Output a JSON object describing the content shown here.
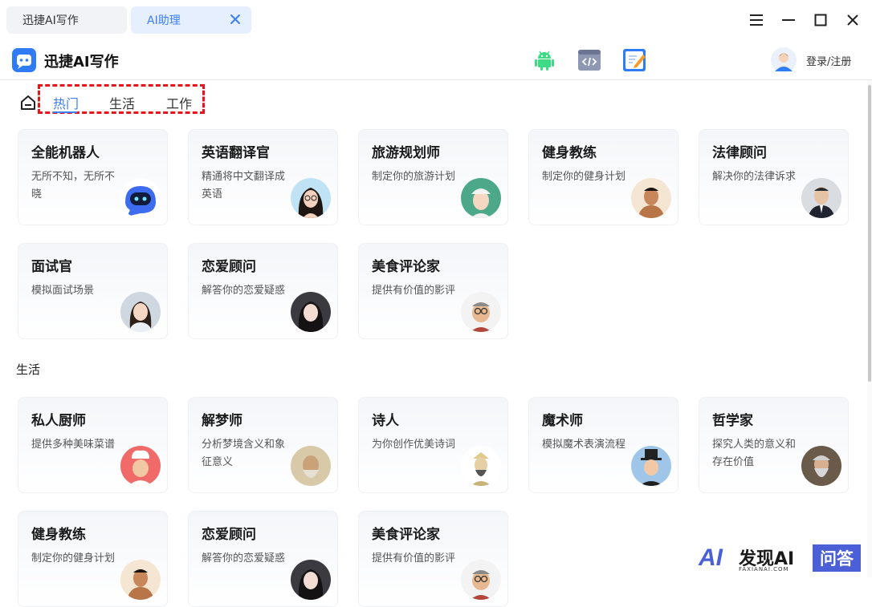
{
  "tabs": [
    {
      "label": "迅捷AI写作"
    },
    {
      "label": "AI助理"
    }
  ],
  "header": {
    "app_title": "迅捷AI写作",
    "login": "登录/注册",
    "icons": [
      "android-icon",
      "code-icon",
      "edit-icon"
    ]
  },
  "categories": [
    "热门",
    "生活",
    "工作"
  ],
  "active_category": "热门",
  "section_life": "生活",
  "cards_hot": [
    {
      "name": "全能机器人",
      "desc": "无所不知，无所不晓",
      "avatar": "robot"
    },
    {
      "name": "英语翻译官",
      "desc": "精通将中文翻译成英语",
      "avatar": "woman"
    },
    {
      "name": "旅游规划师",
      "desc": "制定你的旅游计划",
      "avatar": "traveler"
    },
    {
      "name": "健身教练",
      "desc": "制定你的健身计划",
      "avatar": "athlete"
    },
    {
      "name": "法律顾问",
      "desc": "解决你的法律诉求",
      "avatar": "lawyer"
    },
    {
      "name": "面试官",
      "desc": "模拟面试场景",
      "avatar": "interviewer"
    },
    {
      "name": "恋爱顾问",
      "desc": "解答你的恋爱疑惑",
      "avatar": "love"
    },
    {
      "name": "美食评论家",
      "desc": "提供有价值的影评",
      "avatar": "critic"
    }
  ],
  "cards_life": [
    {
      "name": "私人厨师",
      "desc": "提供多种美味菜谱",
      "avatar": "chef"
    },
    {
      "name": "解梦师",
      "desc": "分析梦境含义和象征意义",
      "avatar": "sage"
    },
    {
      "name": "诗人",
      "desc": "为你创作优美诗词",
      "avatar": "poet"
    },
    {
      "name": "魔术师",
      "desc": "模拟魔术表演流程",
      "avatar": "magician"
    },
    {
      "name": "哲学家",
      "desc": "探究人类的意义和存在价值",
      "avatar": "philosopher"
    },
    {
      "name": "健身教练",
      "desc": "制定你的健身计划",
      "avatar": "athlete"
    },
    {
      "name": "恋爱顾问",
      "desc": "解答你的恋爱疑惑",
      "avatar": "love"
    },
    {
      "name": "美食评论家",
      "desc": "提供有价值的影评",
      "avatar": "critic"
    }
  ],
  "watermark": {
    "logo": "AI",
    "text": "发现AI",
    "sub": "FAXIANAI.COM",
    "badge": "问答"
  },
  "colors": {
    "accent": "#3b7ff3",
    "highlight_box": "#e8141d",
    "brand": "#4b5fd6"
  }
}
